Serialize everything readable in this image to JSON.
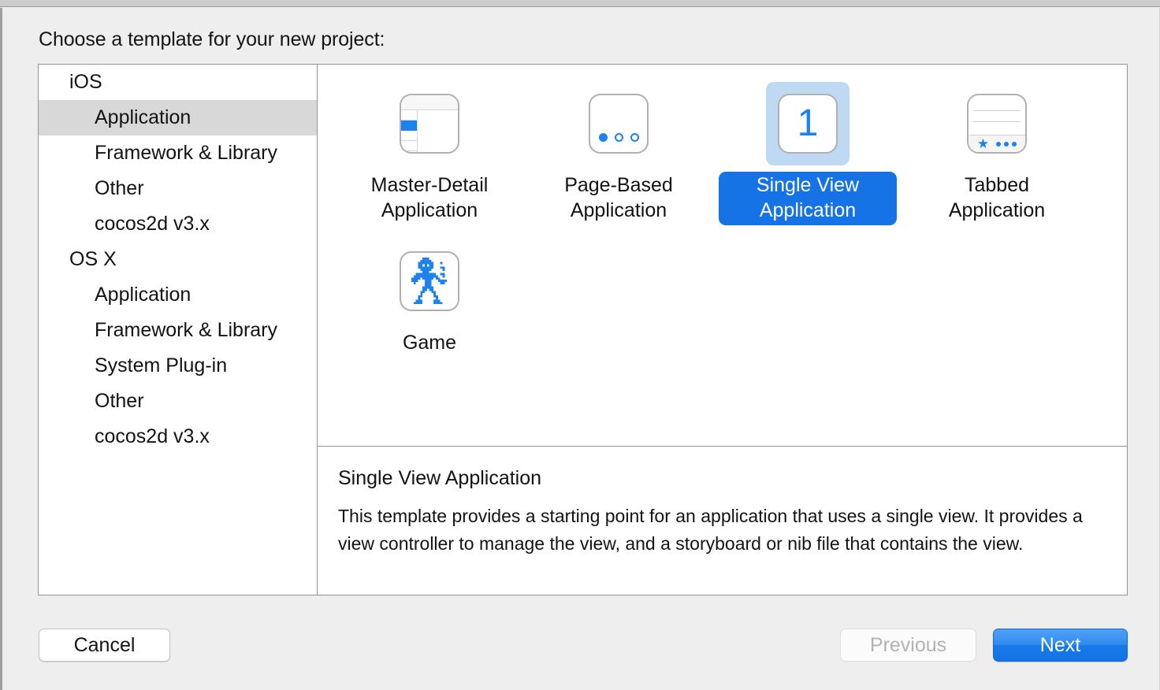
{
  "window": {
    "prompt": "Choose a template for your new project:"
  },
  "sidebar": {
    "items": [
      {
        "label": "iOS",
        "level": "group",
        "selected": false
      },
      {
        "label": "Application",
        "level": "child",
        "selected": true
      },
      {
        "label": "Framework & Library",
        "level": "child",
        "selected": false
      },
      {
        "label": "Other",
        "level": "child",
        "selected": false
      },
      {
        "label": "cocos2d v3.x",
        "level": "child",
        "selected": false
      },
      {
        "label": "OS X",
        "level": "group",
        "selected": false
      },
      {
        "label": "Application",
        "level": "child",
        "selected": false
      },
      {
        "label": "Framework & Library",
        "level": "child",
        "selected": false
      },
      {
        "label": "System Plug-in",
        "level": "child",
        "selected": false
      },
      {
        "label": "Other",
        "level": "child",
        "selected": false
      },
      {
        "label": "cocos2d v3.x",
        "level": "child",
        "selected": false
      }
    ]
  },
  "gallery": {
    "templates": [
      {
        "label": "Master-Detail Application",
        "icon": "master-detail-icon",
        "selected": false
      },
      {
        "label": "Page-Based Application",
        "icon": "page-based-icon",
        "selected": false
      },
      {
        "label": "Single View Application",
        "icon": "single-view-icon",
        "selected": true,
        "badge": "1"
      },
      {
        "label": "Tabbed Application",
        "icon": "tabbed-icon",
        "selected": false
      },
      {
        "label": "Game",
        "icon": "game-icon",
        "selected": false
      }
    ]
  },
  "description": {
    "title": "Single View Application",
    "body": "This template provides a starting point for an application that uses a single view. It provides a view controller to manage the view, and a storyboard or nib file that contains the view."
  },
  "footer": {
    "cancel_label": "Cancel",
    "previous_label": "Previous",
    "next_label": "Next"
  },
  "colors": {
    "accent_blue": "#1b82f0",
    "selection_pill": "#1573e6",
    "selection_tile": "#bfd9f2",
    "sidebar_selection": "#d8d8d8",
    "window_bg": "#efeeee"
  }
}
